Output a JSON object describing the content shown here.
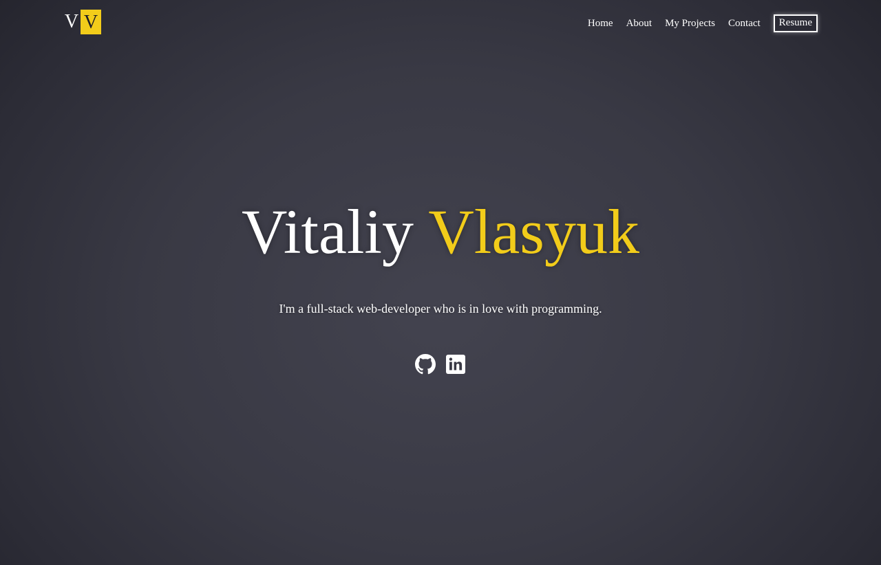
{
  "logo": {
    "first_letter": "V",
    "second_letter": "V"
  },
  "nav": {
    "items": [
      {
        "label": "Home"
      },
      {
        "label": "About"
      },
      {
        "label": "My Projects"
      },
      {
        "label": "Contact"
      }
    ],
    "resume_label": "Resume"
  },
  "hero": {
    "first_name": "Vitaliy",
    "last_name": "Vlasyuk",
    "tagline": "I'm a full-stack web-developer who is in love with programming."
  },
  "socials": [
    {
      "icon": "github-icon"
    },
    {
      "icon": "linkedin-icon"
    }
  ],
  "colors": {
    "accent": "#f2cc1a",
    "text": "#ffffff",
    "background_center": "#43434f",
    "background_edge": "#1f1f27"
  }
}
